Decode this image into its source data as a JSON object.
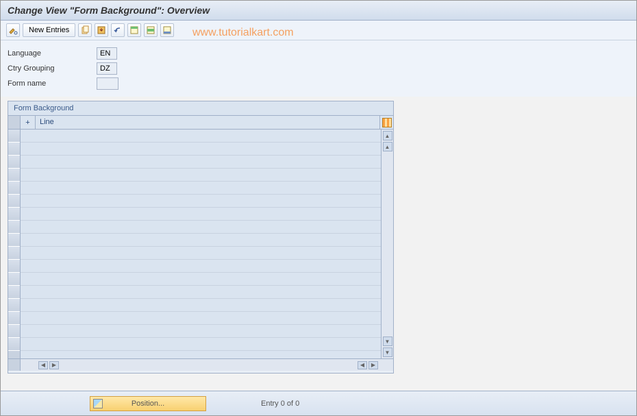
{
  "title": "Change View \"Form Background\": Overview",
  "toolbar": {
    "new_entries": "New Entries",
    "icons": [
      "pencil-glasses-icon",
      "copy-icon",
      "save-icon",
      "undo-icon",
      "select-all-icon",
      "deselect-all-icon",
      "delete-icon"
    ]
  },
  "watermark": "www.tutorialkart.com",
  "form": {
    "language_label": "Language",
    "language_value": "EN",
    "ctry_label": "Ctry Grouping",
    "ctry_value": "DZ",
    "formname_label": "Form name",
    "formname_value": ""
  },
  "table": {
    "title": "Form Background",
    "col_plus": "+",
    "col_line": "Line",
    "row_count": 17
  },
  "footer": {
    "position_label": "Position...",
    "entry_text": "Entry 0 of 0"
  }
}
